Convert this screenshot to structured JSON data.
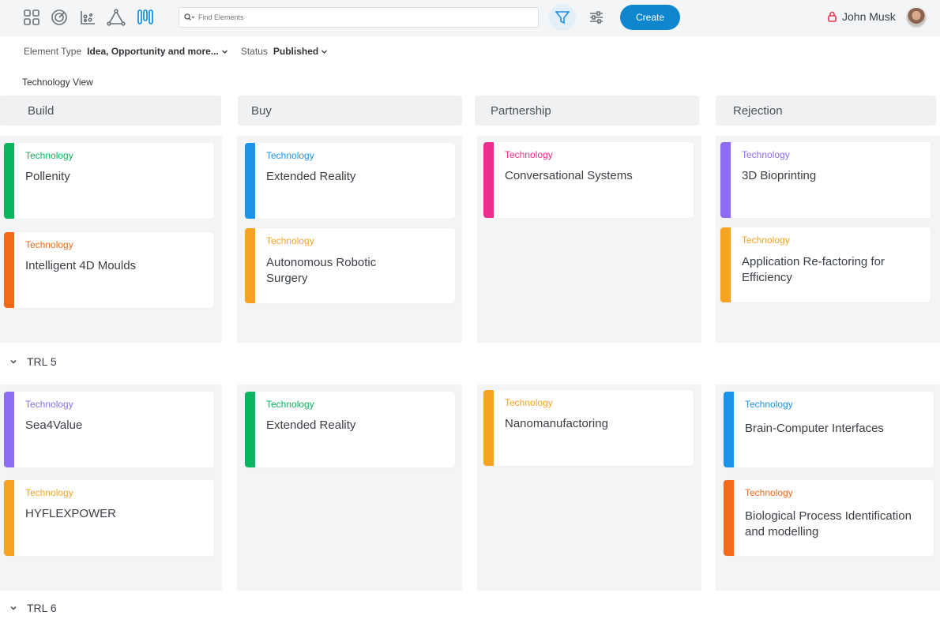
{
  "toolbar": {
    "search_placeholder": "Find Elements",
    "create_label": "Create",
    "user_name": "John Musk"
  },
  "filters": {
    "element_type_label": "Element Type",
    "element_type_value": "Idea, Opportunity and more...",
    "status_label": "Status",
    "status_value": "Published"
  },
  "view_title": "Technology View",
  "columns": [
    "Build",
    "Buy",
    "Partnership",
    "Rejection"
  ],
  "rows": [
    "TRL 5",
    "TRL 6"
  ],
  "colors": {
    "green": "#0bb45f",
    "orange_red": "#f36a1b",
    "blue": "#1a93e8",
    "amber": "#f7a322",
    "pink": "#ec2e8e",
    "purple": "#8e6ef0",
    "accent": "#1086cf"
  },
  "cards": [
    {
      "tag": "Technology",
      "title": "Pollenity",
      "color": "#0bb45f"
    },
    {
      "tag": "Technology",
      "title": "Intelligent 4D Moulds",
      "color": "#f36a1b"
    },
    {
      "tag": "Technology",
      "title": "Extended Reality",
      "color": "#1a93e8"
    },
    {
      "tag": "Technology",
      "title": "Autonomous Robotic",
      "title2": "Surgery",
      "color": "#f7a322"
    },
    {
      "tag": "Technology",
      "title": "Conversational Systems",
      "color": "#ec2e8e"
    },
    {
      "tag": "Technology",
      "title": "3D Bioprinting",
      "color": "#8e6ef0"
    },
    {
      "tag": "Technology",
      "title": "Application Re-factoring for",
      "title2": "Efficiency",
      "color": "#f7a322"
    },
    {
      "tag": "Technology",
      "title": "Sea4Value",
      "color": "#8e6ef0"
    },
    {
      "tag": "Technology",
      "title": "HYFLEXPOWER",
      "color": "#f7a322"
    },
    {
      "tag": "Technology",
      "title": "Extended Reality",
      "color": "#0bb45f"
    },
    {
      "tag": "Technology",
      "title": "Nanomanufactoring",
      "color": "#f7a322"
    },
    {
      "tag": "Technology",
      "title": "Brain-Computer Interfaces",
      "color": "#1a93e8"
    },
    {
      "tag": "Technology",
      "title": "Biological Process Identification",
      "title2": "and modelling",
      "color": "#f36a1b"
    }
  ]
}
